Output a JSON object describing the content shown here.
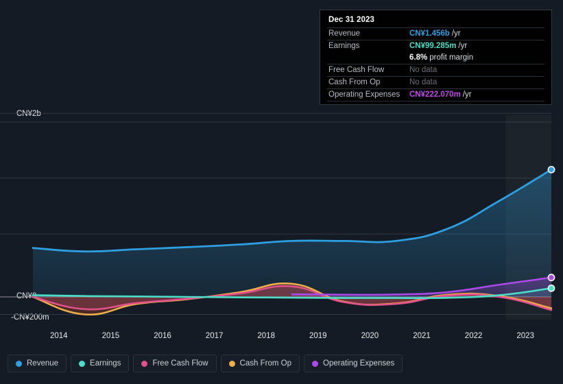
{
  "tooltip": {
    "date": "Dec 31 2023",
    "rows": [
      {
        "label": "Revenue",
        "value": "CN¥1.456b",
        "unit": "/yr",
        "color": "#2e9fe0"
      },
      {
        "label": "Earnings",
        "value": "CN¥99.285m",
        "unit": "/yr",
        "color": "#4adec8"
      },
      {
        "label": "Free Cash Flow",
        "value": "No data",
        "unit": "",
        "color": "#6b7079"
      },
      {
        "label": "Cash From Op",
        "value": "No data",
        "unit": "",
        "color": "#6b7079"
      },
      {
        "label": "Operating Expenses",
        "value": "CN¥222.070m",
        "unit": "/yr",
        "color": "#c04ae8"
      }
    ],
    "profit_margin_value": "6.8%",
    "profit_margin_text": "profit margin"
  },
  "legend": [
    {
      "label": "Revenue",
      "color": "#2e9fe0"
    },
    {
      "label": "Earnings",
      "color": "#4adec8"
    },
    {
      "label": "Free Cash Flow",
      "color": "#e0508a"
    },
    {
      "label": "Cash From Op",
      "color": "#efae4a"
    },
    {
      "label": "Operating Expenses",
      "color": "#aa4ae8"
    }
  ],
  "chart_data": {
    "type": "line",
    "title": "",
    "xlabel": "",
    "ylabel": "",
    "grid": true,
    "legend_position": "bottom",
    "currency": "CN¥",
    "ytick_labels": [
      "CN¥2b",
      "CN¥0",
      "-CN¥200m"
    ],
    "ytick_values": [
      2000,
      0,
      -200
    ],
    "ylim": [
      -260,
      2100
    ],
    "xtick_labels": [
      "2014",
      "2015",
      "2016",
      "2017",
      "2018",
      "2019",
      "2020",
      "2021",
      "2022",
      "2023"
    ],
    "x": [
      2014,
      2015,
      2016,
      2017,
      2018,
      2019,
      2020,
      2021,
      2022,
      2023
    ],
    "units": "CN¥ millions",
    "highlight_from": 2023,
    "series": [
      {
        "name": "Revenue",
        "color": "#2e9fe0",
        "values": [
          560,
          520,
          545,
          570,
          600,
          640,
          640,
          640,
          780,
          1100,
          1456
        ]
      },
      {
        "name": "Earnings",
        "color": "#4adec8",
        "values": [
          20,
          10,
          5,
          0,
          -5,
          -8,
          -12,
          -12,
          -10,
          20,
          99.285
        ]
      },
      {
        "name": "Free Cash Flow",
        "color": "#e0508a",
        "values": [
          0,
          -140,
          -70,
          -20,
          40,
          120,
          -60,
          -80,
          15,
          0,
          -150
        ]
      },
      {
        "name": "Cash From Op",
        "color": "#efae4a",
        "values": [
          0,
          -200,
          -80,
          -25,
          55,
          150,
          -55,
          -75,
          25,
          10,
          -130
        ]
      },
      {
        "name": "Operating Expenses",
        "color": "#aa4ae8",
        "values": [
          null,
          null,
          null,
          null,
          null,
          30,
          25,
          28,
          55,
          140,
          222.07
        ]
      }
    ]
  }
}
